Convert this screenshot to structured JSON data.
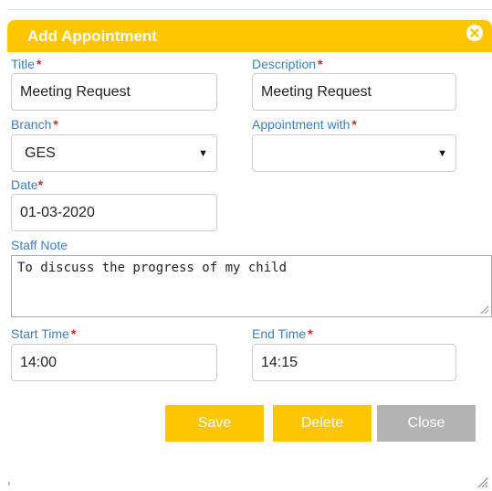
{
  "dialog": {
    "title": "Add Appointment",
    "close_icon": "close-circle-icon",
    "accent_color": "#fec600"
  },
  "form": {
    "title": {
      "label": "Title",
      "required": "*",
      "value": "Meeting Request"
    },
    "description": {
      "label": "Description",
      "required": "*",
      "value": "Meeting Request"
    },
    "branch": {
      "label": "Branch",
      "required": "*",
      "value": "GES"
    },
    "appointment_with": {
      "label": "Appointment with",
      "required": "*",
      "value": ""
    },
    "date": {
      "label": "Date",
      "required": "*",
      "value": "01-03-2020"
    },
    "staff_note": {
      "label": "Staff Note",
      "value": "To discuss the progress of my child"
    },
    "start_time": {
      "label": "Start Time",
      "required": "*",
      "value": "14:00"
    },
    "end_time": {
      "label": "End Time",
      "required": "*",
      "value": "14:15"
    }
  },
  "buttons": {
    "save": "Save",
    "delete": "Delete",
    "close": "Close"
  }
}
